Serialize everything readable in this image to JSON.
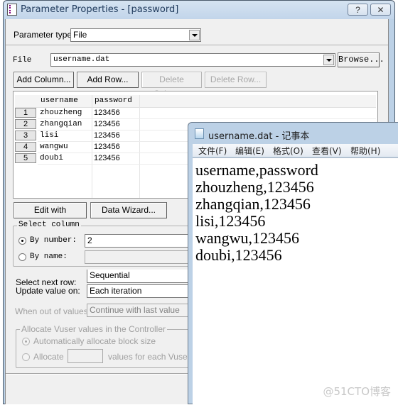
{
  "dialog": {
    "title": "Parameter Properties - [password]",
    "help_button": "?",
    "close_button": "✕",
    "parameter_type_label": "Parameter type:",
    "parameter_type_value": "File",
    "file_label": "File",
    "file_value": "username.dat",
    "browse_button": "Browse...",
    "add_column_button": "Add Column...",
    "add_row_button": "Add Row...",
    "delete_column_button": "Delete Column...",
    "delete_row_button": "Delete Row...",
    "grid": {
      "columns": [
        "username",
        "password"
      ],
      "rows": [
        {
          "num": "1",
          "username": "zhouzheng",
          "password": "123456"
        },
        {
          "num": "2",
          "username": "zhangqian",
          "password": "123456"
        },
        {
          "num": "3",
          "username": "lisi",
          "password": "123456"
        },
        {
          "num": "4",
          "username": "wangwu",
          "password": "123456"
        },
        {
          "num": "5",
          "username": "doubi",
          "password": "123456"
        }
      ]
    },
    "edit_notepad_button": "Edit with Notepad...",
    "data_wizard_button": "Data Wizard...",
    "select_column": {
      "legend": "Select column",
      "by_number_label": "By number:",
      "by_number_value": "2",
      "by_number_selected": true,
      "by_name_label": "By name:",
      "by_name_value": ""
    },
    "select_next_row_label": "Select next row:",
    "select_next_row_value": "Sequential",
    "update_value_label": "Update value on:",
    "update_value_value": "Each iteration",
    "out_of_values_label": "When out of values:",
    "out_of_values_value": "Continue with last value",
    "allocate": {
      "legend": "Allocate Vuser values in the Controller",
      "auto_label": "Automatically allocate block size",
      "auto_selected": true,
      "allocate_label": "Allocate",
      "allocate_value": "",
      "allocate_suffix": "values for each Vuser"
    }
  },
  "notepad": {
    "title": "username.dat - 记事本",
    "menu": [
      "文件(F)",
      "编辑(E)",
      "格式(O)",
      "查看(V)",
      "帮助(H)"
    ],
    "lines": [
      "username,password",
      "zhouzheng,123456",
      "zhangqian,123456",
      "lisi,123456",
      "wangwu,123456",
      "doubi,123456"
    ]
  },
  "watermark": "@51CTO博客"
}
